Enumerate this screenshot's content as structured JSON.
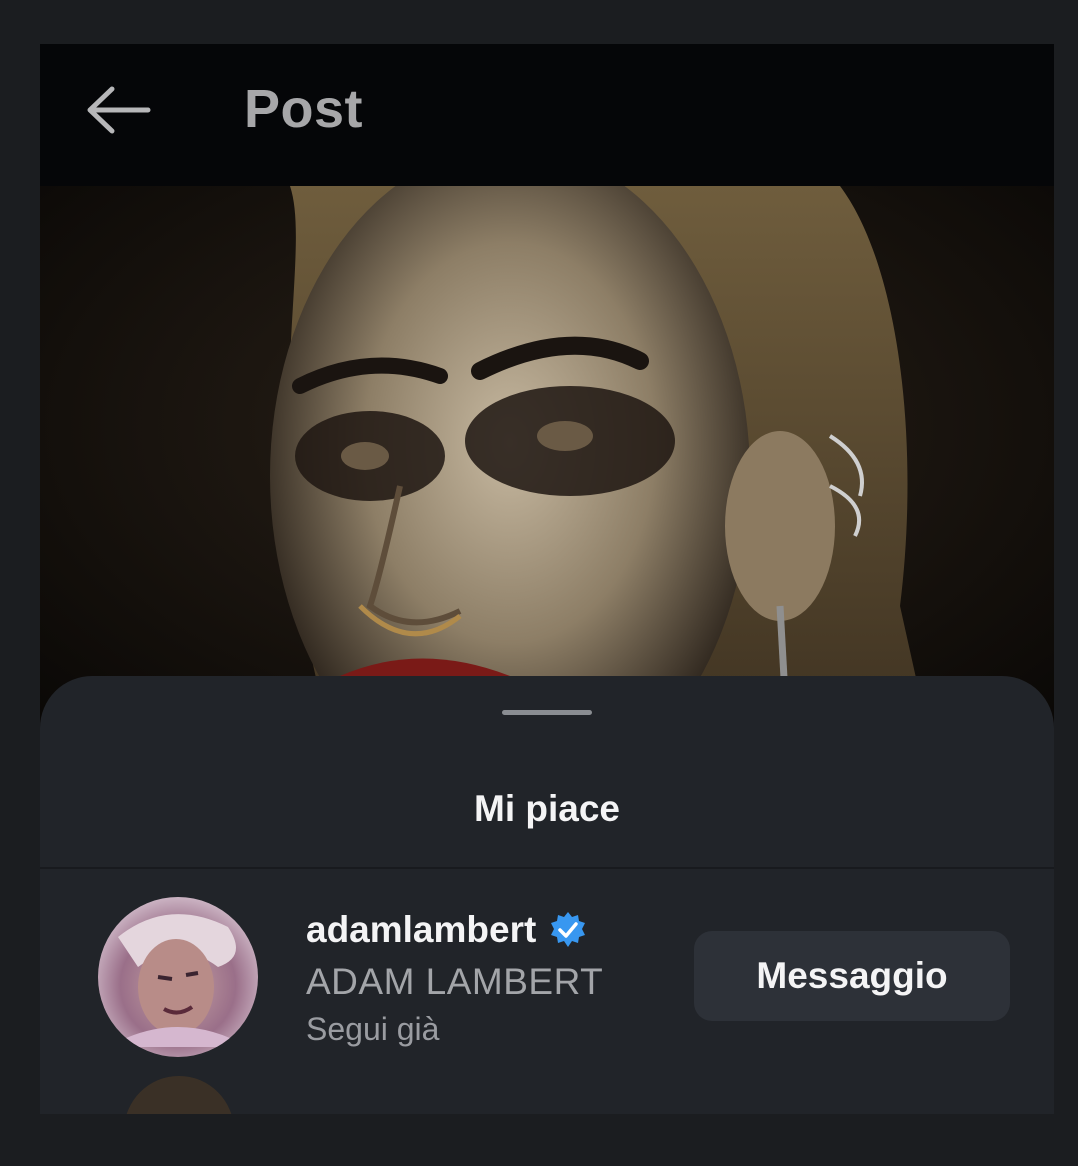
{
  "header": {
    "title": "Post",
    "back_icon": "arrow-left-icon"
  },
  "post": {
    "image_description": ""
  },
  "likes_sheet": {
    "title": "Mi piace",
    "users": [
      {
        "username": "adamlambert",
        "verified": true,
        "full_name": "ADAM LAMBERT",
        "status": "Segui già",
        "action_label": "Messaggio"
      }
    ]
  },
  "colors": {
    "background": "#1b1d20",
    "sheet": "#212429",
    "button": "#2d3138",
    "verified_badge": "#3897f0"
  }
}
